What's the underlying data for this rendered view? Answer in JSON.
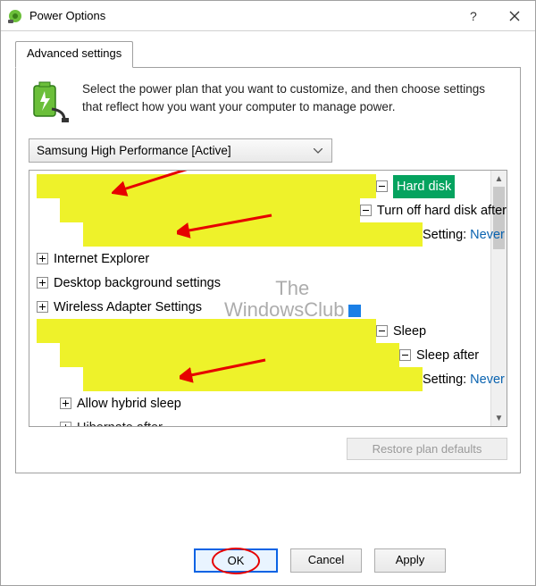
{
  "window": {
    "title": "Power Options"
  },
  "tab": {
    "label": "Advanced settings"
  },
  "intro": "Select the power plan that you want to customize, and then choose settings that reflect how you want your computer to manage power.",
  "dropdown": {
    "value": "Samsung High Performance [Active]"
  },
  "tree": {
    "hard_disk": "Hard disk",
    "turn_off": "Turn off hard disk after",
    "setting_label": "Setting:",
    "hd_value": "Never",
    "ie": "Internet Explorer",
    "desktop_bg": "Desktop background settings",
    "wireless": "Wireless Adapter Settings",
    "sleep": "Sleep",
    "sleep_after": "Sleep after",
    "sleep_value": "Never",
    "hybrid": "Allow hybrid sleep",
    "hibernate": "Hibernate after"
  },
  "buttons": {
    "restore": "Restore plan defaults",
    "ok": "OK",
    "cancel": "Cancel",
    "apply": "Apply"
  },
  "watermark": {
    "line1": "The",
    "line2": "WindowsClub"
  }
}
